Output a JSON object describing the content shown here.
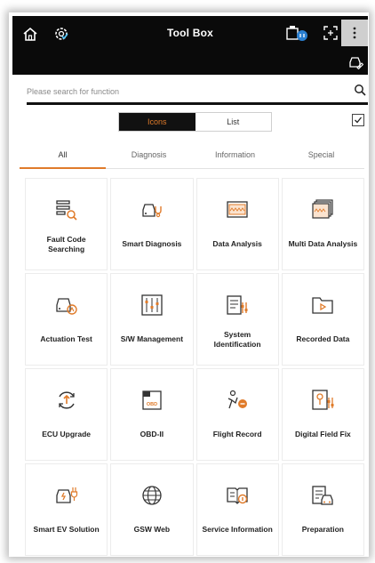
{
  "header": {
    "title": "Tool Box"
  },
  "search": {
    "placeholder": "Please search for function"
  },
  "view_toggle": {
    "icons_label": "Icons",
    "list_label": "List",
    "active": "Icons"
  },
  "tabs": [
    {
      "label": "All",
      "active": true
    },
    {
      "label": "Diagnosis",
      "active": false
    },
    {
      "label": "Information",
      "active": false
    },
    {
      "label": "Special",
      "active": false
    }
  ],
  "tiles": [
    {
      "label": "Fault Code Searching",
      "icon": "fault-code-search-icon"
    },
    {
      "label": "Smart Diagnosis",
      "icon": "smart-diagnosis-icon"
    },
    {
      "label": "Data Analysis",
      "icon": "data-analysis-icon"
    },
    {
      "label": "Multi Data Analysis",
      "icon": "multi-data-analysis-icon"
    },
    {
      "label": "Actuation Test",
      "icon": "actuation-test-icon"
    },
    {
      "label": "S/W Management",
      "icon": "sw-management-icon"
    },
    {
      "label": "System Identification",
      "icon": "system-identification-icon"
    },
    {
      "label": "Recorded Data",
      "icon": "recorded-data-icon"
    },
    {
      "label": "ECU Upgrade",
      "icon": "ecu-upgrade-icon"
    },
    {
      "label": "OBD-II",
      "icon": "obd-icon"
    },
    {
      "label": "Flight Record",
      "icon": "flight-record-icon"
    },
    {
      "label": "Digital Field Fix",
      "icon": "digital-field-fix-icon"
    },
    {
      "label": "Smart EV Solution",
      "icon": "smart-ev-icon"
    },
    {
      "label": "GSW Web",
      "icon": "globe-icon"
    },
    {
      "label": "Service Information",
      "icon": "service-information-icon"
    },
    {
      "label": "Preparation",
      "icon": "preparation-icon"
    }
  ],
  "icon_text": {
    "obd": "OBD",
    "data": ".AAA."
  },
  "colors": {
    "accent": "#e07b2a",
    "header_bg": "#0a0a0a"
  }
}
